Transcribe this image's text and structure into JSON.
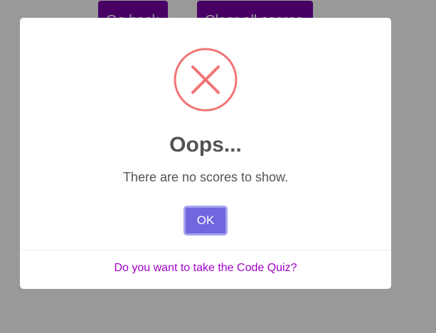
{
  "background": {
    "go_back_label": "Go back",
    "clear_scores_label": "Clear all scores"
  },
  "dialog": {
    "icon": "error-x-icon",
    "title": "Oops...",
    "message": "There are no scores to show.",
    "confirm_label": "OK",
    "footer_link": "Do you want to take the Code Quiz?"
  },
  "colors": {
    "accent_purple": "#7a00a8",
    "ok_button": "#7066e0",
    "error_red": "#f27474",
    "link": "#a000c8"
  }
}
